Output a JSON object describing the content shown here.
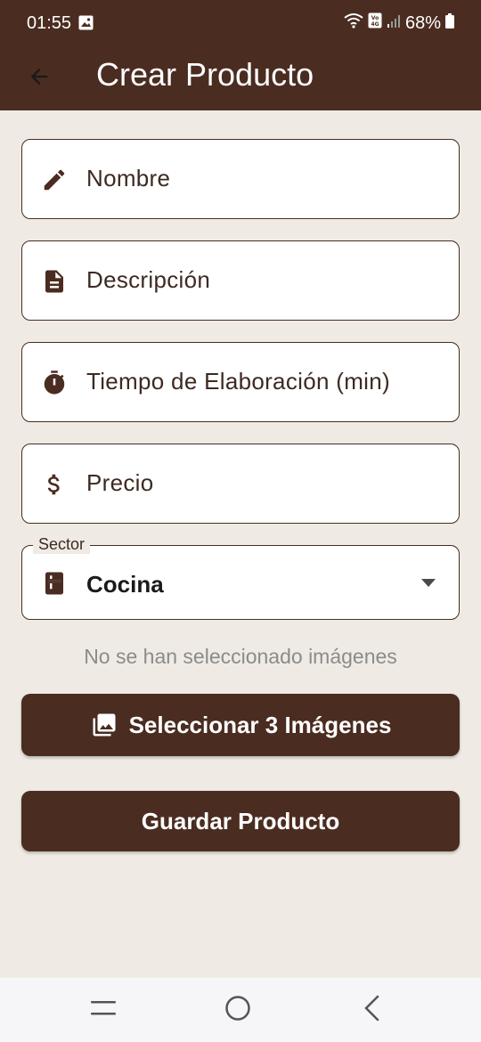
{
  "status_bar": {
    "time": "01:55",
    "battery": "68%",
    "icons": [
      "image-icon",
      "wifi-icon",
      "volte-icon",
      "signal-icon",
      "battery-icon"
    ]
  },
  "app_bar": {
    "title": "Crear Producto",
    "back_icon": "arrow-back-icon"
  },
  "form": {
    "fields": [
      {
        "label": "Nombre",
        "icon": "pencil-icon"
      },
      {
        "label": "Descripción",
        "icon": "document-icon"
      },
      {
        "label": "Tiempo de Elaboración (min)",
        "icon": "timer-icon"
      },
      {
        "label": "Precio",
        "icon": "dollar-icon"
      }
    ],
    "sector": {
      "label": "Sector",
      "value": "Cocina",
      "icon": "kitchen-icon"
    },
    "images_hint": "No se han seleccionado imágenes",
    "select_images_button": "Seleccionar 3 Imágenes",
    "save_button": "Guardar Producto"
  },
  "colors": {
    "primary": "#4a2c21",
    "background": "#efebe4",
    "surface": "#ffffff",
    "hint": "#8b8b8b"
  },
  "nav_bar": [
    "recents-icon",
    "home-icon",
    "back-icon"
  ]
}
